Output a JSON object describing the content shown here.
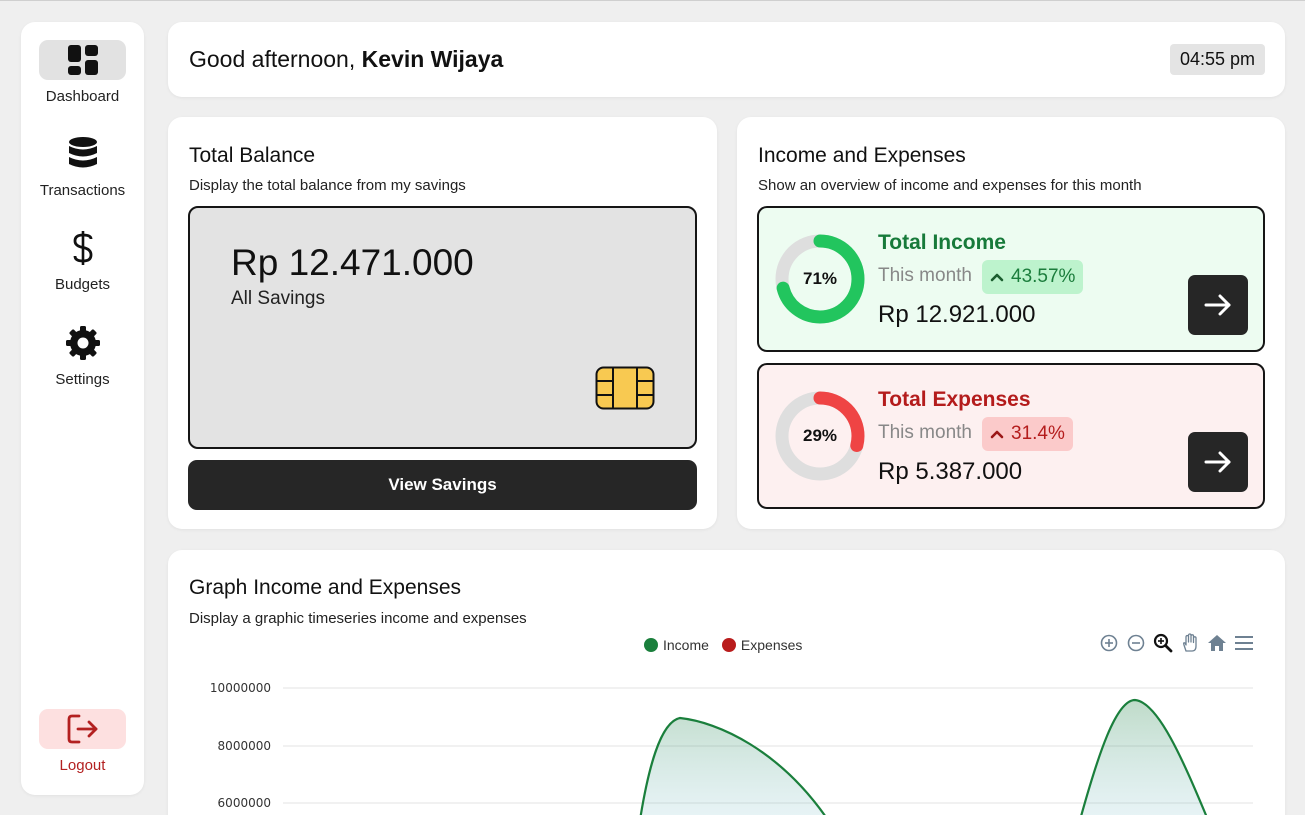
{
  "sidebar": {
    "items": [
      {
        "label": "Dashboard",
        "icon": "dashboard-grid-icon",
        "active": true
      },
      {
        "label": "Transactions",
        "icon": "database-icon",
        "active": false
      },
      {
        "label": "Budgets",
        "icon": "dollar-icon",
        "active": false
      },
      {
        "label": "Settings",
        "icon": "gear-icon",
        "active": false
      }
    ],
    "logout": {
      "label": "Logout",
      "icon": "logout-icon"
    }
  },
  "header": {
    "greeting": "Good afternoon,",
    "user_name": "Kevin Wijaya",
    "time": "04:55 pm"
  },
  "balance": {
    "title": "Total Balance",
    "subtitle": "Display the total balance from my savings",
    "amount": "Rp 12.471.000",
    "label": "All Savings",
    "button": "View Savings"
  },
  "income_expenses": {
    "title": "Income and Expenses",
    "subtitle": "Show an overview of income and expenses for this month",
    "income": {
      "title": "Total Income",
      "period": "This month",
      "change": "43.57%",
      "percent_label": "71%",
      "percent": 71,
      "amount": "Rp 12.921.000",
      "color": "#22c55e"
    },
    "expenses": {
      "title": "Total Expenses",
      "period": "This month",
      "change": "31.4%",
      "percent_label": "29%",
      "percent": 29,
      "amount": "Rp 5.387.000",
      "color": "#ef4444"
    }
  },
  "graph": {
    "title": "Graph Income and Expenses",
    "subtitle": "Display a graphic timeseries income and expenses"
  },
  "chart_data": {
    "type": "area",
    "series": [
      {
        "name": "Income",
        "color": "#1a7f3c"
      },
      {
        "name": "Expenses",
        "color": "#b91c1c"
      }
    ],
    "y_ticks": [
      "10000000",
      "8000000",
      "6000000"
    ],
    "visible_income_peaks": [
      9000000,
      9600000
    ],
    "grid": true,
    "legend": "top-center",
    "toolbar": [
      "zoom-in-icon",
      "zoom-out-icon",
      "zoom-select-icon",
      "pan-hand-icon",
      "reset-home-icon",
      "menu-icon"
    ]
  }
}
